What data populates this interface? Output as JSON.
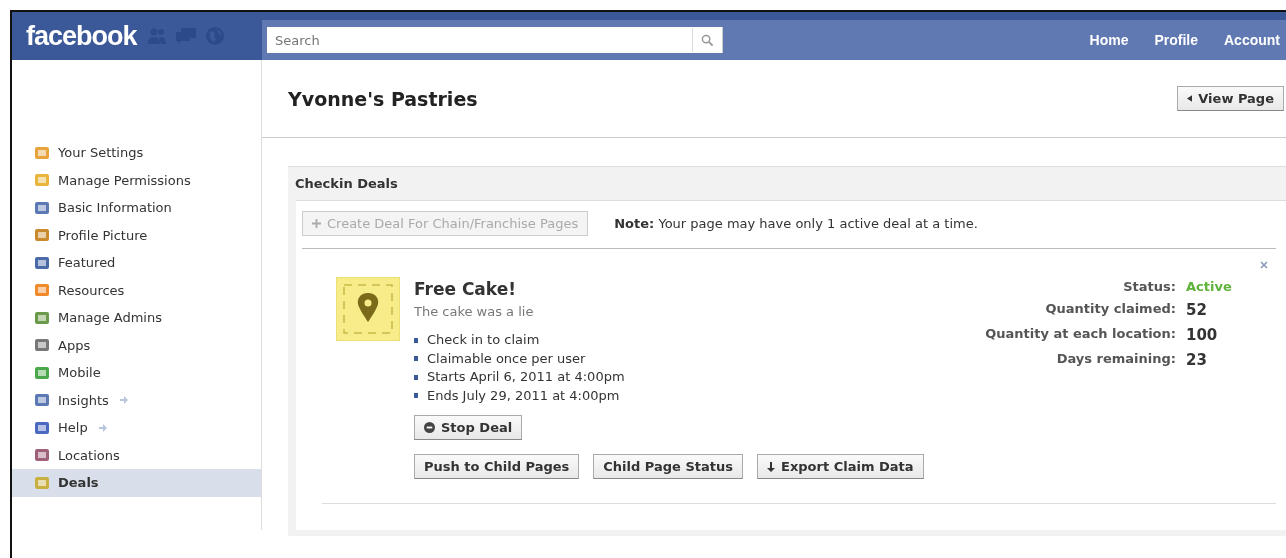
{
  "topbar": {
    "logo": "facebook",
    "search": {
      "placeholder": "Search"
    },
    "nav": [
      "Home",
      "Profile",
      "Account"
    ]
  },
  "sidebar": {
    "items": [
      {
        "label": "Your Settings",
        "selected": false,
        "external": false
      },
      {
        "label": "Manage Permissions",
        "selected": false,
        "external": false
      },
      {
        "label": "Basic Information",
        "selected": false,
        "external": false
      },
      {
        "label": "Profile Picture",
        "selected": false,
        "external": false
      },
      {
        "label": "Featured",
        "selected": false,
        "external": false
      },
      {
        "label": "Resources",
        "selected": false,
        "external": false
      },
      {
        "label": "Manage Admins",
        "selected": false,
        "external": false
      },
      {
        "label": "Apps",
        "selected": false,
        "external": false
      },
      {
        "label": "Mobile",
        "selected": false,
        "external": false
      },
      {
        "label": "Insights",
        "selected": false,
        "external": true
      },
      {
        "label": "Help",
        "selected": false,
        "external": true
      },
      {
        "label": "Locations",
        "selected": false,
        "external": false
      },
      {
        "label": "Deals",
        "selected": true,
        "external": false
      }
    ]
  },
  "page": {
    "title": "Yvonne's Pastries",
    "view_button": "View Page"
  },
  "section": {
    "title": "Checkin Deals",
    "create_button": {
      "label": "Create Deal For Chain/Franchise Pages",
      "disabled": true
    },
    "note": "**Note:** Your page may have only 1 active deal at a time."
  },
  "deal": {
    "title": "Free Cake!",
    "subtitle": "The cake was a lie",
    "details": [
      "Check in to claim",
      "Claimable once per user",
      "Starts April 6, 2011 at 4:00pm",
      "Ends July 29, 2011 at 4:00pm"
    ],
    "stats": [
      {
        "label": "Status:",
        "value": "Active",
        "kind": "status"
      },
      {
        "label": "Quantity claimed:",
        "value": "52",
        "kind": "count"
      },
      {
        "label": "Quantity at each location:",
        "value": "100",
        "kind": "count"
      },
      {
        "label": "Days remaining:",
        "value": "23",
        "kind": "count"
      }
    ],
    "stop_button": "Stop Deal",
    "actions": [
      {
        "label": "Push to Child Pages",
        "kind": "plain"
      },
      {
        "label": "Child Page Status",
        "kind": "plain"
      },
      {
        "label": "Export Claim Data",
        "kind": "download"
      }
    ]
  }
}
